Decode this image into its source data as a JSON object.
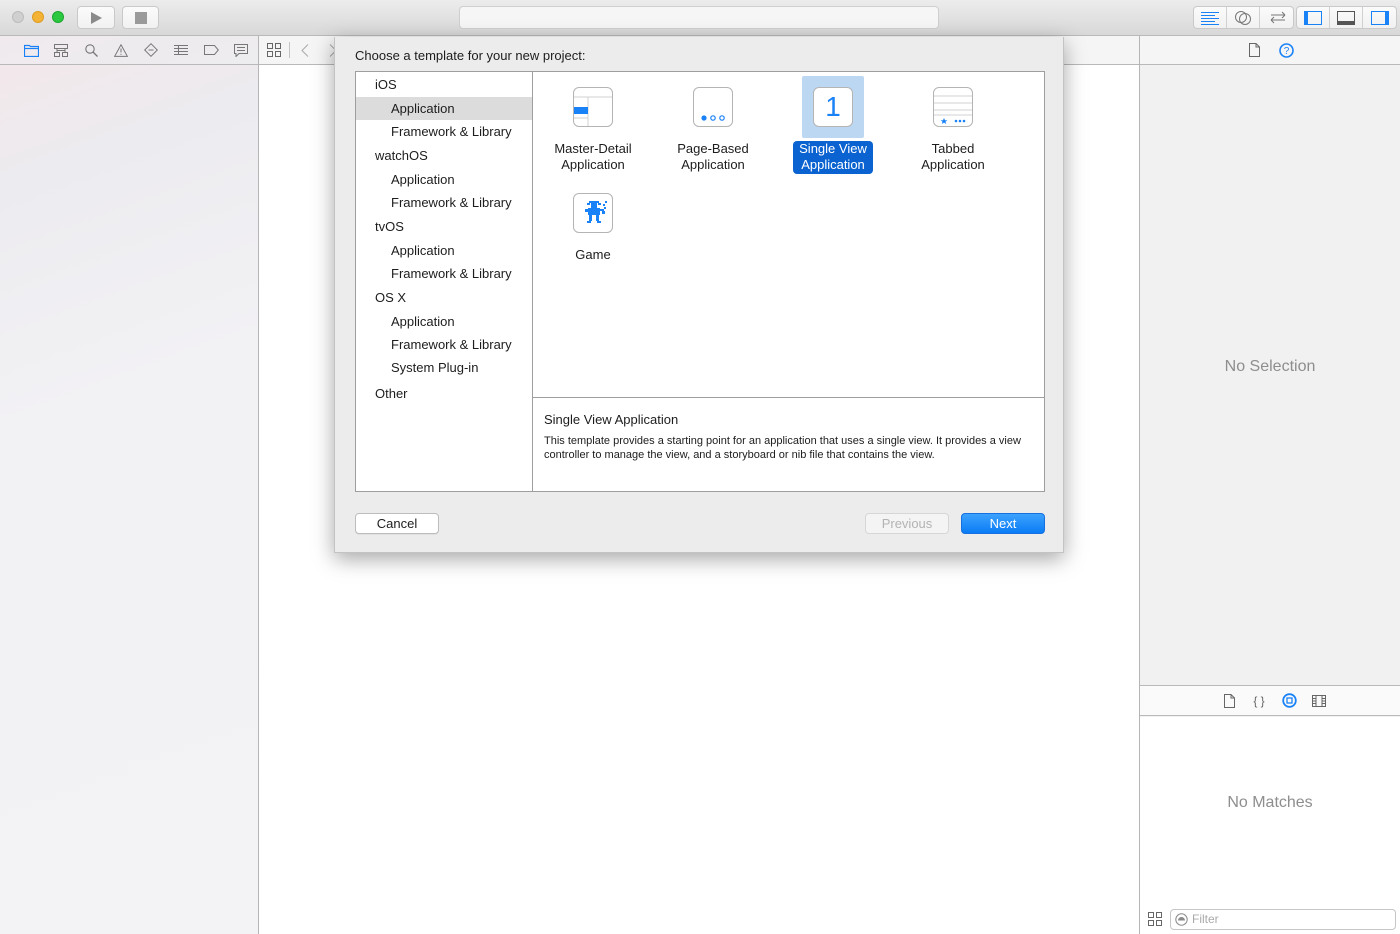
{
  "window": {
    "toolbar": {
      "run_icon": "play-icon",
      "stop_icon": "stop-icon",
      "activity_text": "",
      "editor_modes": [
        "standard-editor-icon",
        "assistant-editor-icon",
        "version-editor-icon"
      ],
      "view_toggles": [
        "navigator-panel-icon",
        "debug-area-icon",
        "utilities-panel-icon"
      ]
    },
    "navigator_tabs": [
      "project-navigator-icon",
      "symbol-navigator-icon",
      "find-navigator-icon",
      "issue-navigator-icon",
      "test-navigator-icon",
      "debug-navigator-icon",
      "breakpoint-navigator-icon",
      "report-navigator-icon"
    ],
    "jump_bar": [
      "related-items-icon",
      "back-icon",
      "forward-icon"
    ]
  },
  "sheet": {
    "title": "Choose a template for your new project:",
    "categories": [
      {
        "platform": "iOS",
        "items": [
          "Application",
          "Framework & Library"
        ]
      },
      {
        "platform": "watchOS",
        "items": [
          "Application",
          "Framework & Library"
        ]
      },
      {
        "platform": "tvOS",
        "items": [
          "Application",
          "Framework & Library"
        ]
      },
      {
        "platform": "OS X",
        "items": [
          "Application",
          "Framework & Library",
          "System Plug-in"
        ]
      },
      {
        "platform": "Other",
        "items": []
      }
    ],
    "selected_category": "iOS / Application",
    "templates": [
      {
        "line1": "Master-Detail",
        "line2": "Application",
        "icon": "master-detail-icon"
      },
      {
        "line1": "Page-Based",
        "line2": "Application",
        "icon": "page-based-icon"
      },
      {
        "line1": "Single View",
        "line2": "Application",
        "icon": "single-view-icon",
        "glyph": "1"
      },
      {
        "line1": "Tabbed",
        "line2": "Application",
        "icon": "tabbed-icon"
      },
      {
        "line1": "Game",
        "line2": "",
        "icon": "game-icon"
      }
    ],
    "selected_template": "Single View Application",
    "description": {
      "title": "Single View Application",
      "body": "This template provides a starting point for an application that uses a single view. It provides a view controller to manage the view, and a storyboard or nib file that contains the view."
    },
    "buttons": {
      "cancel": "Cancel",
      "previous": "Previous",
      "next": "Next"
    }
  },
  "inspector": {
    "tabs": [
      "file-inspector-icon",
      "quick-help-icon"
    ],
    "no_selection": "No Selection",
    "library_tabs": [
      "file-template-library-icon",
      "code-snippet-library-icon",
      "object-library-icon",
      "media-library-icon"
    ],
    "no_matches": "No Matches",
    "filter_placeholder": "Filter"
  },
  "colors": {
    "accent": "#0a7cf5",
    "selection_label": "#0a63d0",
    "selection_icon_bg": "#bcd7f1",
    "icon_blue": "#1a82f7"
  }
}
